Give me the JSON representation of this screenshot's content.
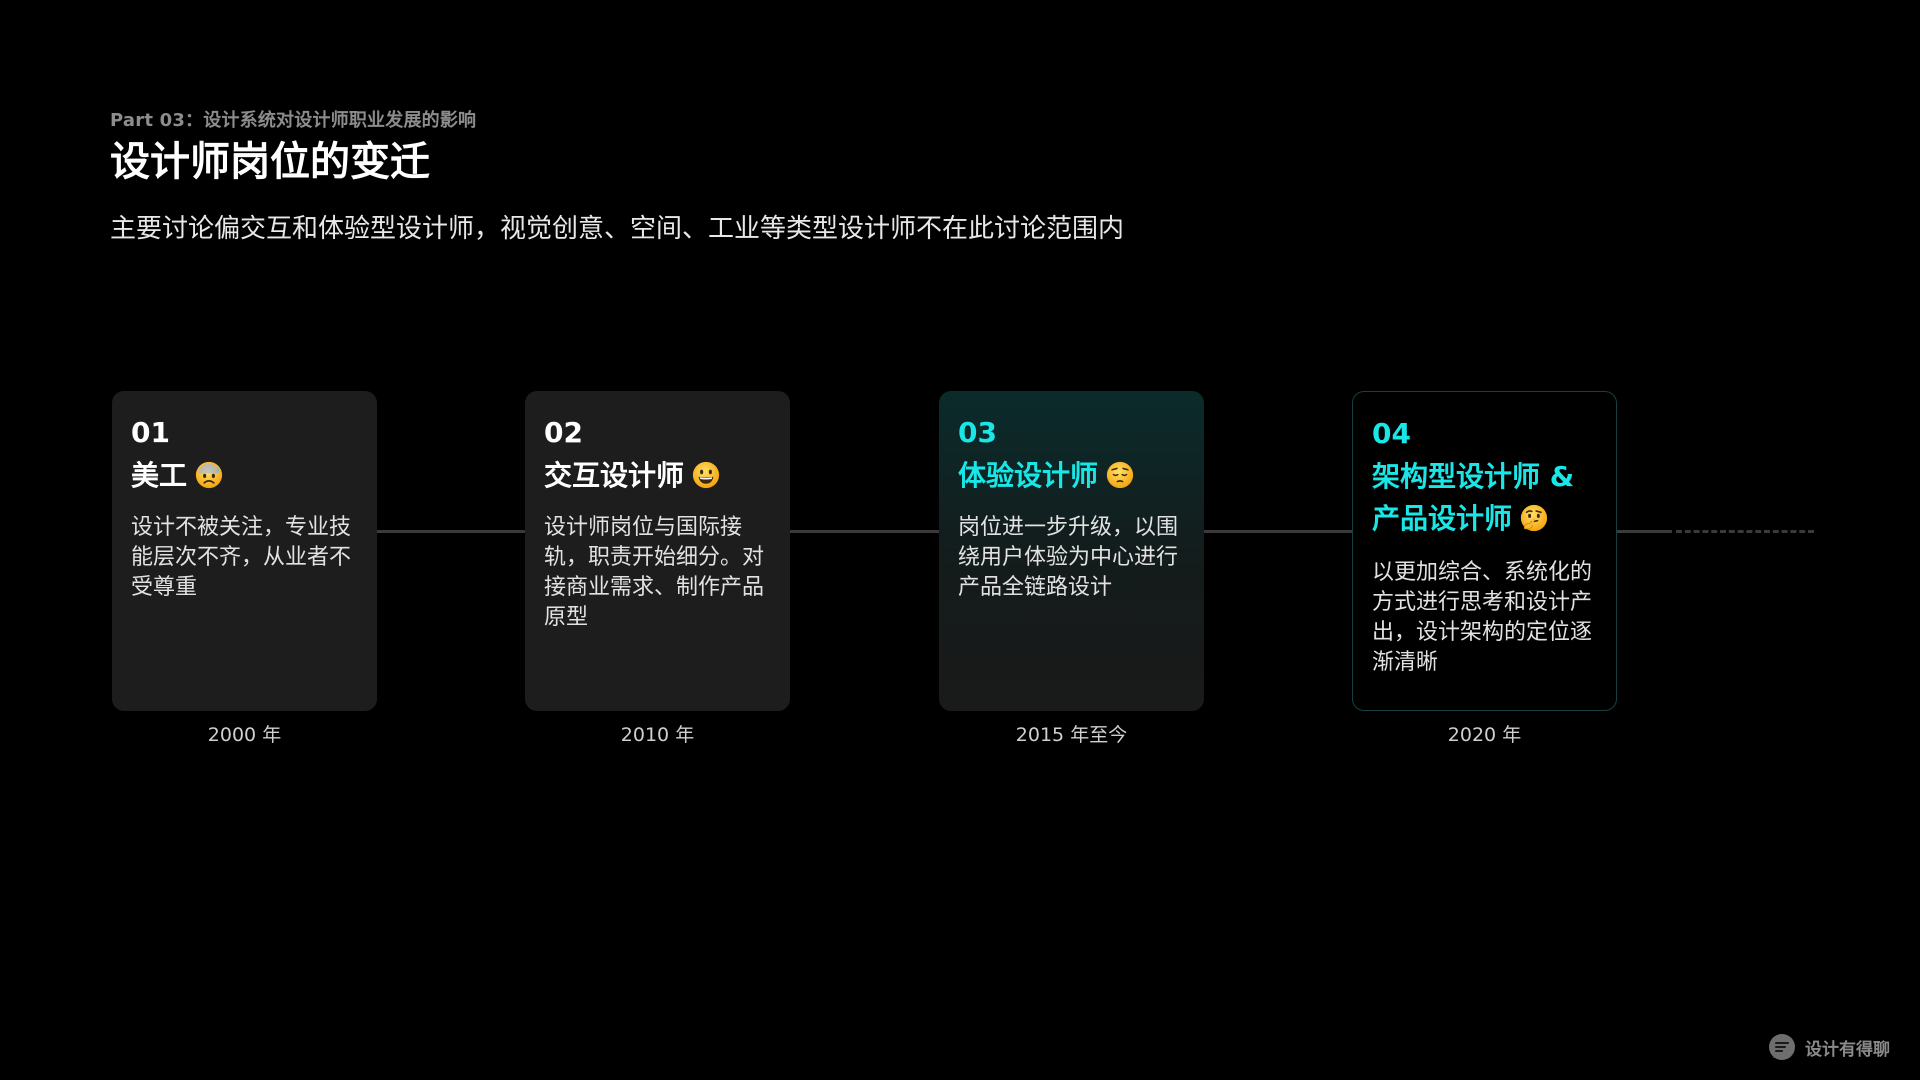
{
  "header": {
    "part_label": "Part 03：设计系统对设计师职业发展的影响",
    "title": "设计师岗位的变迁",
    "subtitle": "主要讨论偏交互和体验型设计师，视觉创意、空间、工业等类型设计师不在此讨论范围内"
  },
  "cards": [
    {
      "number": "01",
      "title": "美工",
      "emoji": "sad-sweat-face-icon",
      "description": "设计不被关注，专业技能层次不齐，从业者不受尊重",
      "year": "2000 年"
    },
    {
      "number": "02",
      "title": "交互设计师",
      "emoji": "grinning-face-icon",
      "description": "设计师岗位与国际接轨，职责开始细分。对接商业需求、制作产品原型",
      "year": "2010 年"
    },
    {
      "number": "03",
      "title": "体验设计师",
      "emoji": "pensive-face-icon",
      "description": "岗位进一步升级，以围绕用户体验为中心进行产品全链路设计",
      "year": "2015 年至今"
    },
    {
      "number": "04",
      "title": "架构型设计师 & 产品设计师",
      "emoji": "thinking-face-icon",
      "description": "以更加综合、系统化的方式进行思考和设计产出，设计架构的定位逐渐清晰",
      "year": "2020 年"
    }
  ],
  "brand": {
    "text": "设计有得聊",
    "icon": "chat-logo-icon"
  },
  "colors": {
    "background": "#000000",
    "accent": "#19e6e6",
    "card": "#1d1d1d",
    "timeline": "#3a3a3a"
  }
}
